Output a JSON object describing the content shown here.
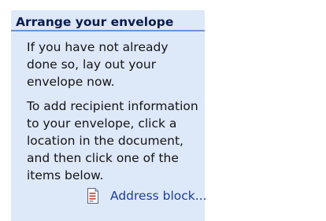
{
  "pane": {
    "section_title": "Arrange your envelope",
    "instruction_1": "If you have not already done so, lay out your envelope now.",
    "instruction_2": "To add recipient information to your envelope, click a location in the document, and then click one of the items below.",
    "items": [
      {
        "label": "Address block...",
        "icon": "address-block-icon"
      }
    ]
  },
  "colors": {
    "section_background": "#dde8f9",
    "header_underline": "#6e92cf",
    "link_text": "#1c3f94"
  }
}
